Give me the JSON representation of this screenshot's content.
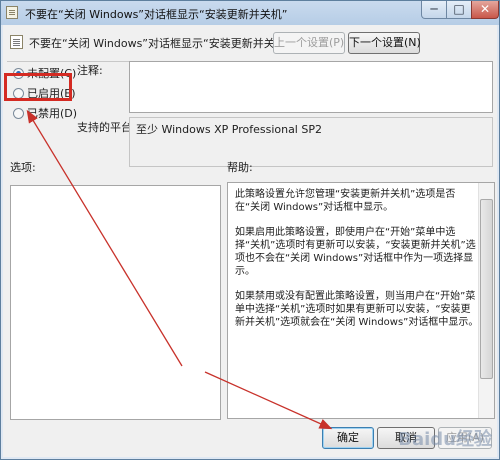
{
  "window": {
    "title": "不要在“关闭 Windows”对话框显示“安装更新并关机”",
    "controls": {
      "minimize": "─",
      "maximize": "□",
      "close": "✕"
    }
  },
  "header": {
    "title": "不要在“关闭 Windows”对话框显示“安装更新并关机”",
    "prev_button": "上一个设置(P)",
    "next_button": "下一个设置(N)"
  },
  "options": {
    "not_configured": "未配置(C)",
    "enabled": "已启用(E)",
    "disabled": "已禁用(D)",
    "selected": "not_configured"
  },
  "comment": {
    "label": "注释:"
  },
  "platform": {
    "label": "支持的平台:",
    "value": "至少 Windows XP Professional SP2"
  },
  "sections": {
    "options_label": "选项:",
    "help_label": "帮助:"
  },
  "help": {
    "p1": "此策略设置允许您管理“安装更新并关机”选项是否在“关闭 Windows”对话框中显示。",
    "p2": "如果启用此策略设置，即使用户在“开始”菜单中选择“关机”选项时有更新可以安装，“安装更新并关机”选项也不会在“关闭 Windows”对话框中作为一项选择显示。",
    "p3": "如果禁用或没有配置此策略设置，则当用户在“开始”菜单中选择“关机”选项时如果有更新可以安装，“安装更新并关机”选项就会在“关闭 Windows”对话框中显示。"
  },
  "footer": {
    "ok": "确定",
    "cancel": "取消",
    "apply": "应用(A)"
  },
  "annotation": {
    "color": "#c8322b"
  },
  "watermark": "Baidu经验"
}
